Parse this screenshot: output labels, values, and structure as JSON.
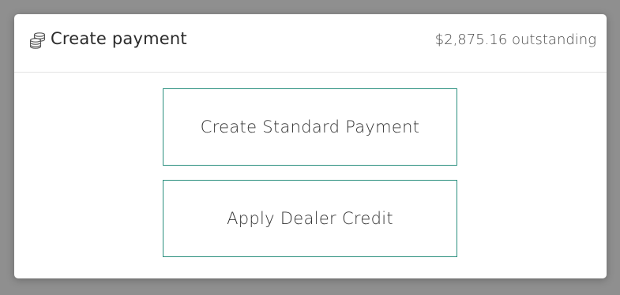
{
  "header": {
    "icon": "coins-stack-icon",
    "title": "Create payment",
    "outstanding": "$2,875.16 outstanding"
  },
  "options": {
    "standard_payment": "Create Standard Payment",
    "dealer_credit": "Apply Dealer Credit"
  },
  "colors": {
    "accent": "#2a8f7e",
    "backdrop": "#8f8f8f"
  }
}
